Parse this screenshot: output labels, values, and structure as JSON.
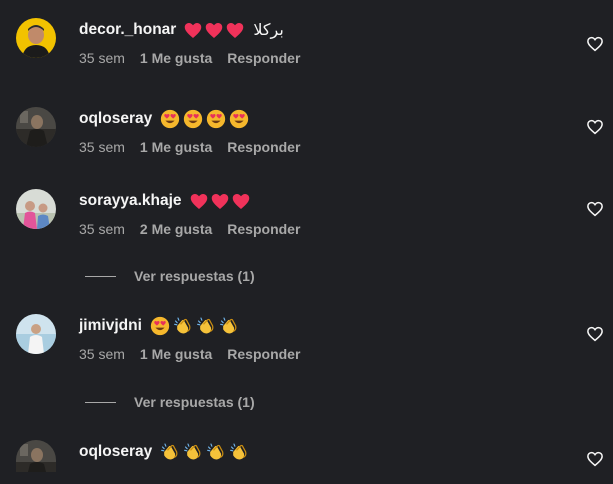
{
  "comments": [
    {
      "username": "decor._honar",
      "emojis": [
        "heart",
        "heart",
        "heart"
      ],
      "text": "بركلا",
      "time": "35 sem",
      "likes": "1 Me gusta",
      "reply": "Responder"
    },
    {
      "username": "oqloseray",
      "emojis": [
        "heart-eyes",
        "heart-eyes",
        "heart-eyes",
        "heart-eyes"
      ],
      "time": "35 sem",
      "likes": "1 Me gusta",
      "reply": "Responder"
    },
    {
      "username": "sorayya.khaje",
      "emojis": [
        "heart",
        "heart",
        "heart"
      ],
      "time": "35 sem",
      "likes": "2 Me gusta",
      "reply": "Responder",
      "view_replies": "Ver respuestas (1)"
    },
    {
      "username": "jimivjdni",
      "emojis": [
        "heart-eyes",
        "clap",
        "clap",
        "clap"
      ],
      "time": "35 sem",
      "likes": "1 Me gusta",
      "reply": "Responder",
      "view_replies": "Ver respuestas (1)"
    },
    {
      "username": "oqloseray",
      "emojis": [
        "clap",
        "clap",
        "clap",
        "clap"
      ]
    }
  ],
  "colors": {
    "background": "#1f2024",
    "primary_text": "#f5f5f5",
    "secondary_text": "#a8a8a8",
    "heart_emoji": "#f0325a"
  },
  "icons": {
    "like": "heart-outline-icon"
  }
}
